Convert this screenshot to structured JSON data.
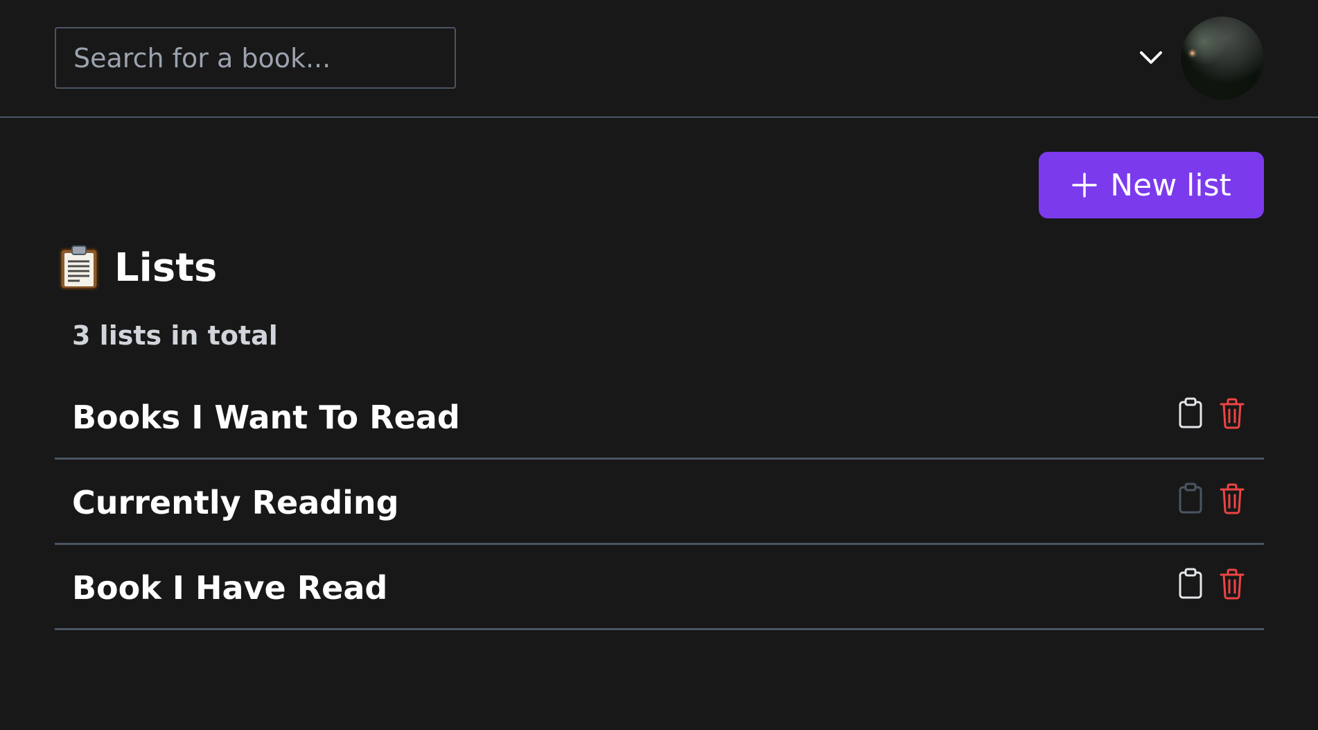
{
  "search": {
    "placeholder": "Search for a book..."
  },
  "header": {
    "menu_icon": "chevron-down-icon",
    "avatar": "user-avatar"
  },
  "toolbar": {
    "new_list_label": "New list",
    "new_list_icon": "plus-icon"
  },
  "page": {
    "emoji_icon": "clipboard-emoji-icon",
    "title": "Lists",
    "subtitle": "3 lists in total"
  },
  "lists": [
    {
      "title": "Books I Want To Read",
      "copy_icon": "clipboard-icon",
      "delete_icon": "trash-icon"
    },
    {
      "title": "Currently Reading",
      "copy_icon": "clipboard-icon",
      "delete_icon": "trash-icon"
    },
    {
      "title": "Book I Have Read",
      "copy_icon": "clipboard-icon",
      "delete_icon": "trash-icon"
    }
  ],
  "colors": {
    "background": "#181818",
    "accent": "#7c3aed",
    "border": "#4b5563",
    "danger": "#ef4444",
    "icon": "#e5e7eb",
    "icon_dim": "#4b5563"
  }
}
